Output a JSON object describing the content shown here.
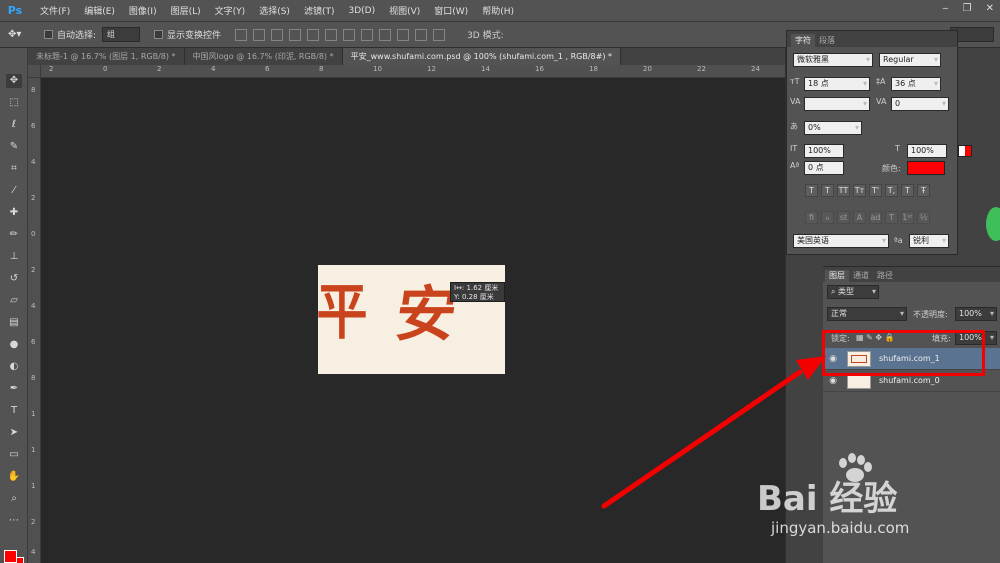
{
  "app": {
    "logo": "Ps",
    "menu": [
      "文件(F)",
      "编辑(E)",
      "图像(I)",
      "图层(L)",
      "文字(Y)",
      "选择(S)",
      "滤镜(T)",
      "3D(D)",
      "视图(V)",
      "窗口(W)",
      "帮助(H)"
    ]
  },
  "options": {
    "auto_select_label": "自动选择:",
    "auto_select_value": "组",
    "show_transform_label": "显示变换控件",
    "mode3d_label": "3D 模式:"
  },
  "tabs": [
    {
      "label": "未标题-1 @ 16.7% (图层 1, RGB/8) *"
    },
    {
      "label": "中国风logo @ 16.7% (印泥, RGB/8) *"
    },
    {
      "label": "平安_www.shufami.com.psd @ 100% (shufami.com_1 , RGB/8#) *"
    }
  ],
  "rulers": {
    "top": [
      "2",
      "0",
      "2",
      "4",
      "6",
      "8",
      "10",
      "12",
      "14",
      "16",
      "18",
      "20",
      "22",
      "24"
    ],
    "left": [
      "8",
      "6",
      "4",
      "2",
      "0",
      "2",
      "4",
      "6",
      "8",
      "1",
      "1",
      "1",
      "2",
      "4"
    ]
  },
  "canvas": {
    "glyph1": "平",
    "glyph2": "安",
    "info_w": "1.62 厘米",
    "info_h": "0.28 厘米",
    "info_w_prefix": "I↔:",
    "info_h_prefix": "Y:"
  },
  "character_panel": {
    "tabs": [
      "字符",
      "段落"
    ],
    "font_family": "微软雅黑",
    "font_style": "Regular",
    "font_size": "18 点",
    "leading": "36 点",
    "tracking": "0",
    "tsume": "0%",
    "vscale": "100%",
    "hscale": "100%",
    "baseline": "0 点",
    "color_label": "颜色:",
    "style_buttons": [
      "T",
      "T",
      "TT",
      "Tт",
      "T'",
      "T,",
      "T",
      "Ŧ"
    ],
    "language": "美国英语",
    "aa_icon": "ªa",
    "antialias": "锐利"
  },
  "layers_panel": {
    "tabs": [
      "图层",
      "通道",
      "路径"
    ],
    "filter_label": "类型",
    "blend_mode": "正常",
    "opacity_label": "不透明度:",
    "opacity_value": "100%",
    "lock_label": "锁定:",
    "fill_label": "填充:",
    "fill_value": "100%",
    "layers": [
      {
        "name": "shufami.com_1",
        "selected": true
      },
      {
        "name": "shufami.com_0",
        "selected": false
      }
    ]
  },
  "watermark": {
    "brand": "Bai  经验",
    "url": "jingyan.baidu.com"
  },
  "colors": {
    "foreground": "#ff0000",
    "background": "#ff0000",
    "annotation": "#f50000",
    "text_color_swatch": "#ff0000",
    "calligraphy": "#c9431c"
  }
}
